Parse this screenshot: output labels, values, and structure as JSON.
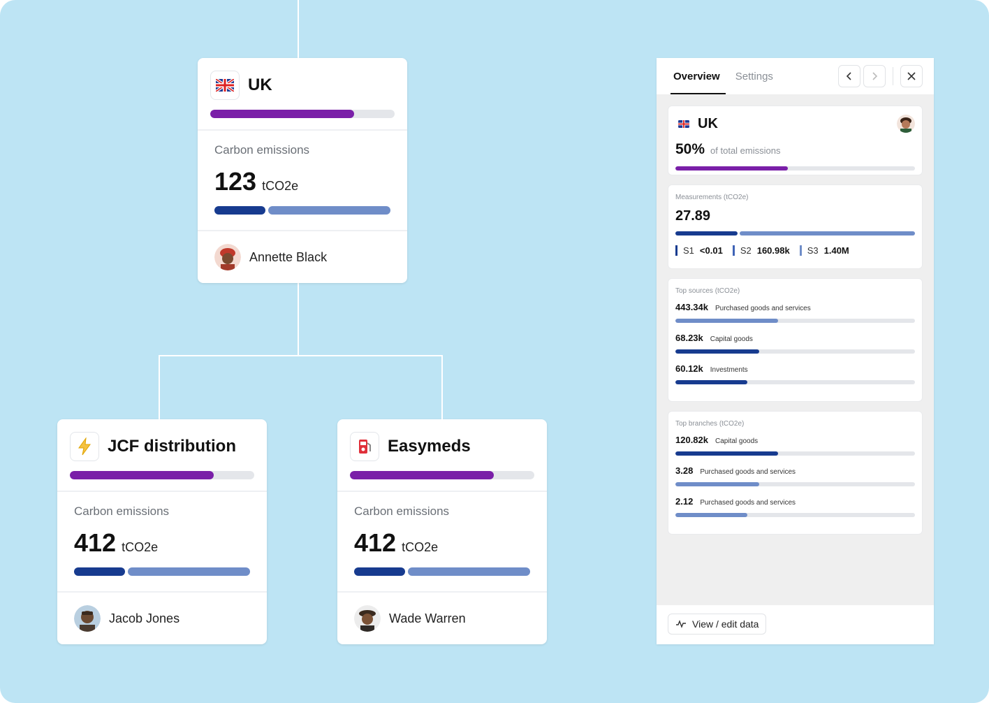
{
  "nodes": {
    "root": {
      "flag_icon": "uk-flag-icon",
      "title": "UK",
      "share": 0.78,
      "emissions_label": "Carbon emissions",
      "emissions_value": "123",
      "emissions_unit": "tCO2e",
      "split": 0.29,
      "owner": "Annette Black",
      "owner_avatar": "avatar-annette-black"
    },
    "left": {
      "icon": "lightning-icon",
      "title": "JCF distribution",
      "share": 0.78,
      "emissions_label": "Carbon emissions",
      "emissions_value": "412",
      "emissions_unit": "tCO2e",
      "split": 0.29,
      "owner": "Jacob Jones",
      "owner_avatar": "avatar-jacob-jones"
    },
    "right": {
      "icon": "fuel-pump-icon",
      "title": "Easymeds",
      "share": 0.78,
      "emissions_label": "Carbon emissions",
      "emissions_value": "412",
      "emissions_unit": "tCO2e",
      "split": 0.29,
      "owner": "Wade Warren",
      "owner_avatar": "avatar-wade-warren"
    }
  },
  "panel": {
    "tabs": [
      {
        "label": "Overview",
        "active": true
      },
      {
        "label": "Settings",
        "active": false
      }
    ],
    "header": {
      "flag_icon": "uk-flag-icon",
      "title": "UK",
      "percent": "50%",
      "percent_label": "of total emissions",
      "progress": 0.47
    },
    "measurements": {
      "label": "Measurements (tCO2e)",
      "value": "27.89",
      "split": 0.26,
      "scopes": [
        {
          "name": "S1",
          "value": "<0.01"
        },
        {
          "name": "S2",
          "value": "160.98k"
        },
        {
          "name": "S3",
          "value": "1.40M"
        }
      ]
    },
    "top_sources": {
      "label": "Top sources (tCO2e)",
      "items": [
        {
          "value": "443.34k",
          "label": "Purchased goods and services",
          "fraction": 0.43,
          "color": "#6f8dc8"
        },
        {
          "value": "68.23k",
          "label": "Capital goods",
          "fraction": 0.35,
          "color": "#173b8f"
        },
        {
          "value": "60.12k",
          "label": "Investments",
          "fraction": 0.3,
          "color": "#173b8f"
        }
      ]
    },
    "top_branches": {
      "label": "Top branches (tCO2e)",
      "items": [
        {
          "value": "120.82k",
          "label": "Capital goods",
          "fraction": 0.43,
          "color": "#173b8f"
        },
        {
          "value": "3.28",
          "label": "Purchased goods and services",
          "fraction": 0.35,
          "color": "#6f8dc8"
        },
        {
          "value": "2.12",
          "label": "Purchased goods and services",
          "fraction": 0.3,
          "color": "#6f8dc8"
        }
      ]
    },
    "footer": {
      "button_label": "View / edit data",
      "icon": "activity-icon"
    }
  },
  "colors": {
    "background": "#bde4f4",
    "purple": "#7a1fa8",
    "navy": "#173b8f",
    "blue": "#6f8dc8"
  }
}
